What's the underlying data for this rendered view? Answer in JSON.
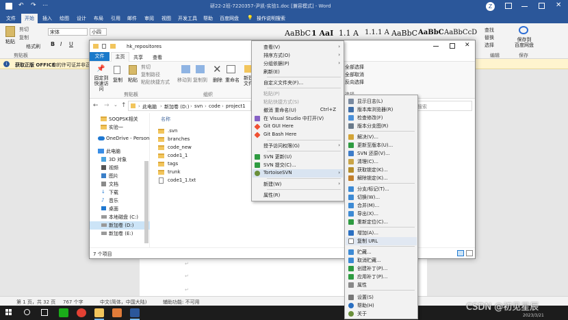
{
  "word": {
    "title": "研22-2班-7220357-尹凯-实验1.doc [兼容模式] - Word",
    "user": "Z",
    "tabs": [
      "文件",
      "开始",
      "插入",
      "绘图",
      "设计",
      "布局",
      "引用",
      "邮件",
      "审阅",
      "视图",
      "开发工具",
      "帮助",
      "百度网盘"
    ],
    "tell_me": "操作说明搜索",
    "paste_label": "粘贴",
    "clipboard_items": [
      "剪切",
      "复制",
      "格式刷"
    ],
    "clipboard_group": "剪贴板",
    "font_name": "宋体",
    "font_size": "小四",
    "find_items": [
      "查找",
      "替换",
      "选择"
    ],
    "edit_group": "编辑",
    "save_baidu": "保存到\n百度网盘",
    "save_group": "保存",
    "styles": [
      "AaBbC",
      "1 AaI",
      "1.1 A",
      "1.1.1 A",
      "AaBbC",
      "AaBbC",
      "AaBbCcD"
    ],
    "info_title": "获取正版 OFFICE",
    "info_text": "你的许可证并非正",
    "status": [
      "第 1 页，共 32 页",
      "767 个字",
      "中文(简体，中国大陆)",
      "辅助功能: 不可用"
    ]
  },
  "explorer": {
    "title": "hk_repositores",
    "tabs": [
      "文件",
      "主页",
      "共享",
      "查看"
    ],
    "ribbon_pin": "固定到\n快速访问",
    "ribbon_copy": "复制",
    "ribbon_paste": "粘贴",
    "ribbon_cut": "剪切",
    "ribbon_copy_path": "复制路径",
    "ribbon_paste_shortcut": "粘贴快捷方式",
    "clipboard_group": "剪贴板",
    "move_to": "移动到",
    "copy_to": "复制到",
    "delete": "删除",
    "rename": "重命名",
    "new_folder": "新建\n文件",
    "organize_group": "组织",
    "select_all": "全部选择",
    "select_none": "全部取消",
    "invert": "反向选择",
    "select_group": "选择",
    "breadcrumb": [
      "此电脑",
      "新加卷 (D:)",
      "svn",
      "code",
      "project1"
    ],
    "search_placeholder": "搜索",
    "column_name": "名称",
    "nav": [
      "SOQPSK相关",
      "实验一",
      "OneDrive - Personal",
      "此电脑",
      "3D 对象",
      "视频",
      "图片",
      "文档",
      "下载",
      "音乐",
      "桌面",
      "本地磁盘 (C:)",
      "新加卷 (D:)",
      "新加卷 (E:)"
    ],
    "files": [
      ".svn",
      "branches",
      "code_new",
      "code1_1",
      "tags",
      "trunk",
      "code1_1.txt"
    ],
    "status": "7 个项目"
  },
  "menu1": {
    "items": [
      {
        "label": "查看(V)",
        "arrow": true
      },
      {
        "label": "排序方式(O)",
        "arrow": true
      },
      {
        "label": "分组依据(P)",
        "arrow": true
      },
      {
        "label": "刷新(E)"
      },
      {
        "label": "自定义文件夹(F)..."
      },
      {
        "label": "粘贴(P)",
        "disabled": true
      },
      {
        "label": "粘贴快捷方式(S)",
        "disabled": true
      },
      {
        "label": "撤消 重命名(U)",
        "shortcut": "Ctrl+Z"
      },
      {
        "label": "在 Visual Studio 中打开(V)"
      },
      {
        "label": "Git GUI Here"
      },
      {
        "label": "Git Bash Here"
      },
      {
        "label": "授予访问权限(G)",
        "arrow": true
      },
      {
        "label": "SVN 更新(U)"
      },
      {
        "label": "SVN 提交(C)..."
      },
      {
        "label": "TortoiseSVN",
        "arrow": true
      },
      {
        "label": "新建(W)",
        "arrow": true
      },
      {
        "label": "属性(R)"
      }
    ]
  },
  "menu2": {
    "items": [
      "显示日志(L)",
      "版本库浏览器(R)",
      "检查修改(F)",
      "版本分支图(R)",
      "解决(V)...",
      "更新至版本(U)...",
      "SVN 还原(V)...",
      "清理(C)...",
      "获取锁定(K)...",
      "解除锁定(K)...",
      "分支/标记(T)...",
      "切换(W)...",
      "合并(M)...",
      "导出(X)...",
      "重新定位(C)...",
      "增加(A)...",
      "复制 URL",
      "贮藏...",
      "取消贮藏...",
      "创建补丁(P)...",
      "应用补丁(P)...",
      "属性",
      "设置(S)",
      "帮助(H)",
      "关于"
    ]
  },
  "watermark": "CSDN @初见星辰",
  "clock": "2023/3/21",
  "colors": {
    "word_blue": "#2b579a",
    "info_bg": "#fff4ce",
    "highlight": "#d9e4f1"
  }
}
